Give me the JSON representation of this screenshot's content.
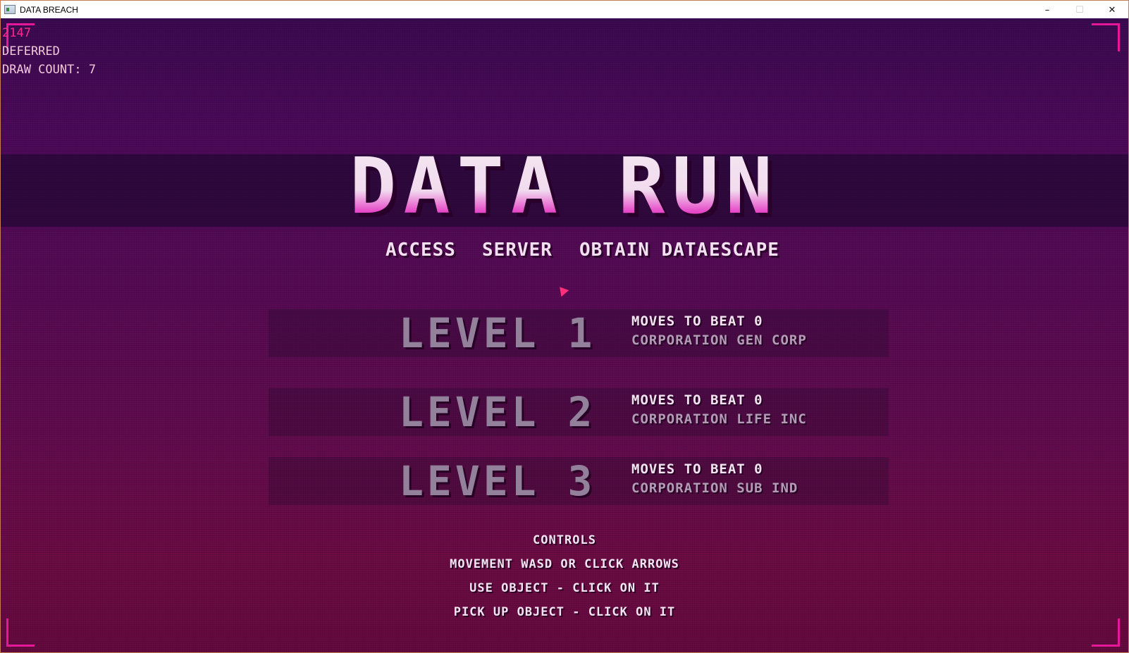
{
  "window": {
    "title": "DATA BREACH",
    "minimize": "–",
    "maximize": "☐",
    "close": "✕"
  },
  "debug": {
    "fps": "2147",
    "mode": "DEFERRED",
    "draw_count": "DRAW COUNT: 7"
  },
  "game": {
    "title": "DATA RUN",
    "subtitles": [
      "ACCESS",
      "SERVER",
      "OBTAIN DATA",
      "ESCAPE"
    ]
  },
  "levels": [
    {
      "name": "LEVEL 1",
      "moves": "MOVES TO BEAT 0",
      "corporation": "CORPORATION GEN CORP"
    },
    {
      "name": "LEVEL 2",
      "moves": "MOVES TO BEAT 0",
      "corporation": "CORPORATION LIFE INC"
    },
    {
      "name": "LEVEL 3",
      "moves": "MOVES TO BEAT 0",
      "corporation": "CORPORATION SUB IND"
    }
  ],
  "controls": {
    "heading": "CONTROLS",
    "movement": "MOVEMENT WASD OR CLICK ARROWS",
    "use_object": "USE OBJECT - CLICK ON IT",
    "pick_up": "PICK UP OBJECT - CLICK ON IT"
  },
  "colors": {
    "accent": "#e6189a",
    "title_gradient_bottom": "#d21fb8",
    "level_text": "#93809a"
  }
}
